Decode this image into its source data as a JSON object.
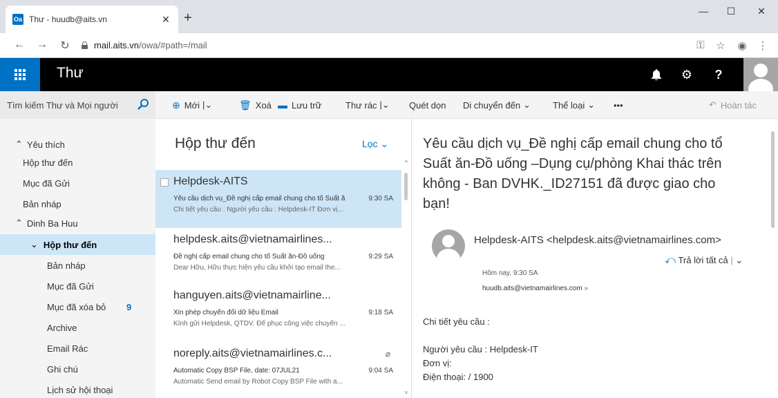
{
  "browser": {
    "tab_title": "Thư - huudb@aits.vn",
    "favicon_label": "Oa",
    "url_host": "mail.aits.vn",
    "url_path": "/owa/#path=/mail"
  },
  "header": {
    "app_title": "Thư",
    "notification_icon": "bell-icon",
    "settings_icon": "gear-icon",
    "help_label": "?"
  },
  "command_bar": {
    "search_placeholder": "Tìm kiếm Thư và Mọi người",
    "new_label": "Mới",
    "delete_label": "Xoá",
    "archive_label": "Lưu trữ",
    "junk_label": "Thư rác",
    "sweep_label": "Quét dọn",
    "move_label": "Di chuyển đến",
    "categories_label": "Thể loại",
    "more_label": "•••",
    "undo_label": "Hoàn tác"
  },
  "nav": {
    "favorites_header": "Yêu thích",
    "favorites": [
      "Hộp thư đến",
      "Mục đã Gửi",
      "Bản nháp"
    ],
    "account_header": "Dinh Ba Huu",
    "folders": [
      {
        "label": "Hộp thư đến",
        "count": ""
      },
      {
        "label": "Bản nháp",
        "count": ""
      },
      {
        "label": "Mục đã Gửi",
        "count": ""
      },
      {
        "label": "Mục đã xóa bỏ",
        "count": "9"
      },
      {
        "label": "Archive",
        "count": ""
      },
      {
        "label": "Email Rác",
        "count": ""
      },
      {
        "label": "Ghi chú",
        "count": ""
      },
      {
        "label": "Lịch sử hội thoại",
        "count": ""
      }
    ]
  },
  "list": {
    "title": "Hộp thư đến",
    "filter_label": "Lọc",
    "messages": [
      {
        "from": "Helpdesk-AITS",
        "subject": "Yêu cầu dịch vụ_Đề nghị cấp email chung cho tổ Suất ăn",
        "time": "9:30 SA",
        "preview": "Chi tiết yêu cầu : Người yêu cầu : Helpdesk-IT Đơn vị..."
      },
      {
        "from": "helpdesk.aits@vietnamairlines...",
        "subject": "Đề nghị cấp email chung cho tổ Suất ăn-Đồ uống",
        "time": "9:29 SA",
        "preview": "Dear Hữu, Hữu thực hiện yêu cầu khởi tạo email the..."
      },
      {
        "from": "hanguyen.aits@vietnamairline...",
        "subject": "Xin phép chuyển đổi dữ liệu Email",
        "time": "9:18 SA",
        "preview": "Kính gửi Helpdesk, QTDV. Để phục công việc chuyển ..."
      },
      {
        "from": "noreply.aits@vietnamairlines.c...",
        "subject": "Automatic Copy BSP File, date: 07JUL21",
        "time": "9:04 SA",
        "preview": "Automatic Send email by Robot Copy BSP File with a..."
      }
    ]
  },
  "reading": {
    "subject": "Yêu cầu dịch vụ_Đề nghị cấp email chung cho tổ Suất ăn-Đồ uống –Dụng cụ/phòng Khai thác trên không - Ban DVHK._ID27151 đã được giao cho bạn!",
    "sender": "Helpdesk-AITS <helpdesk.aits@vietnamairlines.com>",
    "reply_all_label": "Trả lời tất cả",
    "date": "Hôm nay, 9:30 SA",
    "to": "huudb.aits@vietnamairlines.com",
    "body_heading": "Chi tiết yêu cầu :",
    "body_lines": [
      "Người yêu cầu : Helpdesk-IT",
      "Đơn vị:",
      "Điện thoại: / 1900"
    ]
  },
  "colors": {
    "accent": "#0072c6",
    "selected": "#cde6f7",
    "header_bg": "#000000"
  }
}
